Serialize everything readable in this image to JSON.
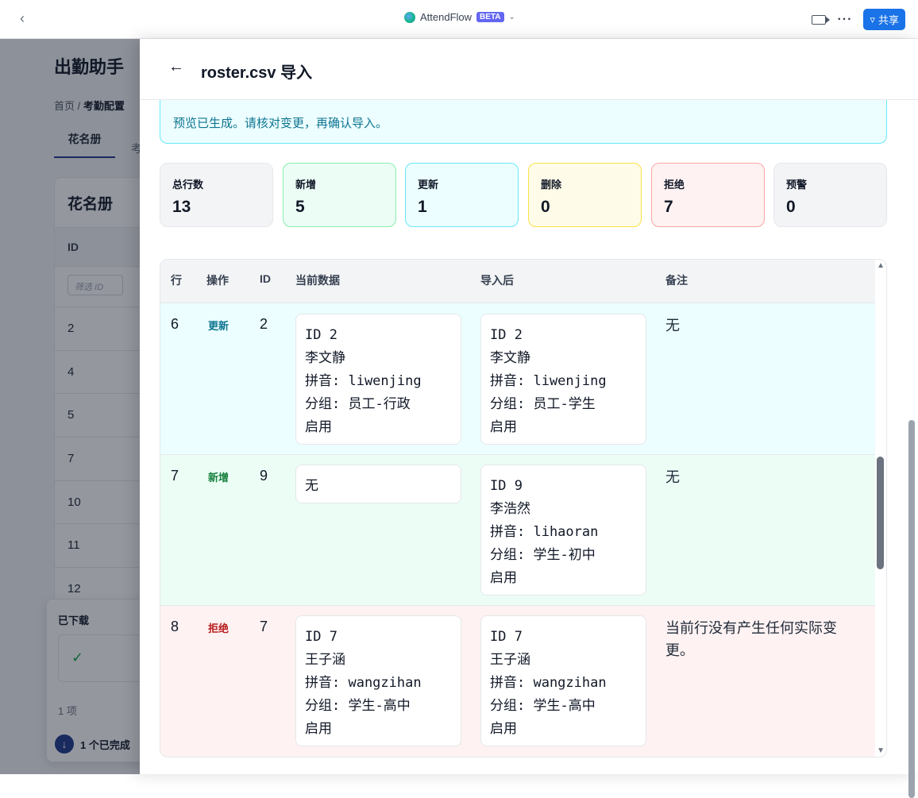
{
  "titlebar": {
    "app_name": "AttendFlow",
    "beta": "BETA",
    "share": "共享",
    "icons": [
      "chevron-left-icon",
      "globe-icon",
      "chevron-down-icon",
      "video-icon",
      "more-icon",
      "share-icon"
    ]
  },
  "background": {
    "title": "出勤助手",
    "crumb_home": "首页",
    "crumb_sep": "/",
    "crumb_current": "考勤配置",
    "tab_active": "花名册",
    "tab_next": "考",
    "card_title": "花名册",
    "col_id": "ID",
    "filter_placeholder": "筛选 ID",
    "row_ids": [
      "2",
      "4",
      "5",
      "7",
      "10",
      "11",
      "12"
    ]
  },
  "downloads": {
    "title": "已下载",
    "count": "1 项",
    "done": "1 个已完成"
  },
  "panel": {
    "title": "roster.csv 导入",
    "notice": "预览已生成。请核对变更，再确认导入。",
    "stats": [
      {
        "label": "总行数",
        "value": "13",
        "bg": "#f3f4f6",
        "border": "#e5e7eb"
      },
      {
        "label": "新增",
        "value": "5",
        "bg": "#ecfdf5",
        "border": "#86efac"
      },
      {
        "label": "更新",
        "value": "1",
        "bg": "#ecfeff",
        "border": "#67e8f9"
      },
      {
        "label": "删除",
        "value": "0",
        "bg": "#fefce8",
        "border": "#fde047"
      },
      {
        "label": "拒绝",
        "value": "7",
        "bg": "#fef2f2",
        "border": "#fca5a5"
      },
      {
        "label": "预警",
        "value": "0",
        "bg": "#f3f4f6",
        "border": "#e5e7eb"
      }
    ],
    "table": {
      "headers": [
        "行",
        "操作",
        "ID",
        "当前数据",
        "导入后",
        "备注"
      ],
      "rows": [
        {
          "row": "6",
          "op": "更新",
          "id": "2",
          "current": [
            "ID 2",
            "李文静",
            "拼音: liwenjing",
            "分组: 员工-行政",
            "启用"
          ],
          "after": [
            "ID 2",
            "李文静",
            "拼音: liwenjing",
            "分组: 员工-学生",
            "启用"
          ],
          "note": "无"
        },
        {
          "row": "7",
          "op": "新增",
          "id": "9",
          "current": [
            "无"
          ],
          "after": [
            "ID 9",
            "李浩然",
            "拼音: lihaoran",
            "分组: 学生-初中",
            "启用"
          ],
          "note": "无"
        },
        {
          "row": "8",
          "op": "拒绝",
          "id": "7",
          "current": [
            "ID 7",
            "王子涵",
            "拼音: wangzihan",
            "分组: 学生-高中",
            "启用"
          ],
          "after": [
            "ID 7",
            "王子涵",
            "拼音: wangzihan",
            "分组: 学生-高中",
            "启用"
          ],
          "note": "当前行没有产生任何实际变更。"
        }
      ]
    }
  }
}
